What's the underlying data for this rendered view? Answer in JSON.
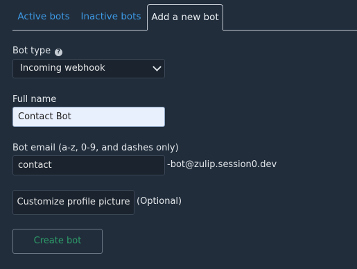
{
  "tabs": [
    {
      "label": "Active bots"
    },
    {
      "label": "Inactive bots"
    },
    {
      "label": "Add a new bot"
    }
  ],
  "form": {
    "bot_type_label": "Bot type",
    "bot_type_help_glyph": "?",
    "bot_type_value": "Incoming webhook",
    "full_name_label": "Full name",
    "full_name_value": "Contact Bot",
    "bot_email_label": "Bot email (a-z, 0-9, and dashes only)",
    "bot_email_value": "contact",
    "bot_email_suffix": "-bot@zulip.session0.dev",
    "customize_button": "Customize profile picture",
    "optional_label": "(Optional)",
    "create_button": "Create bot"
  },
  "colors": {
    "background": "#212d3b",
    "link": "#3d9ae6",
    "create_text": "#2e9d6a"
  }
}
